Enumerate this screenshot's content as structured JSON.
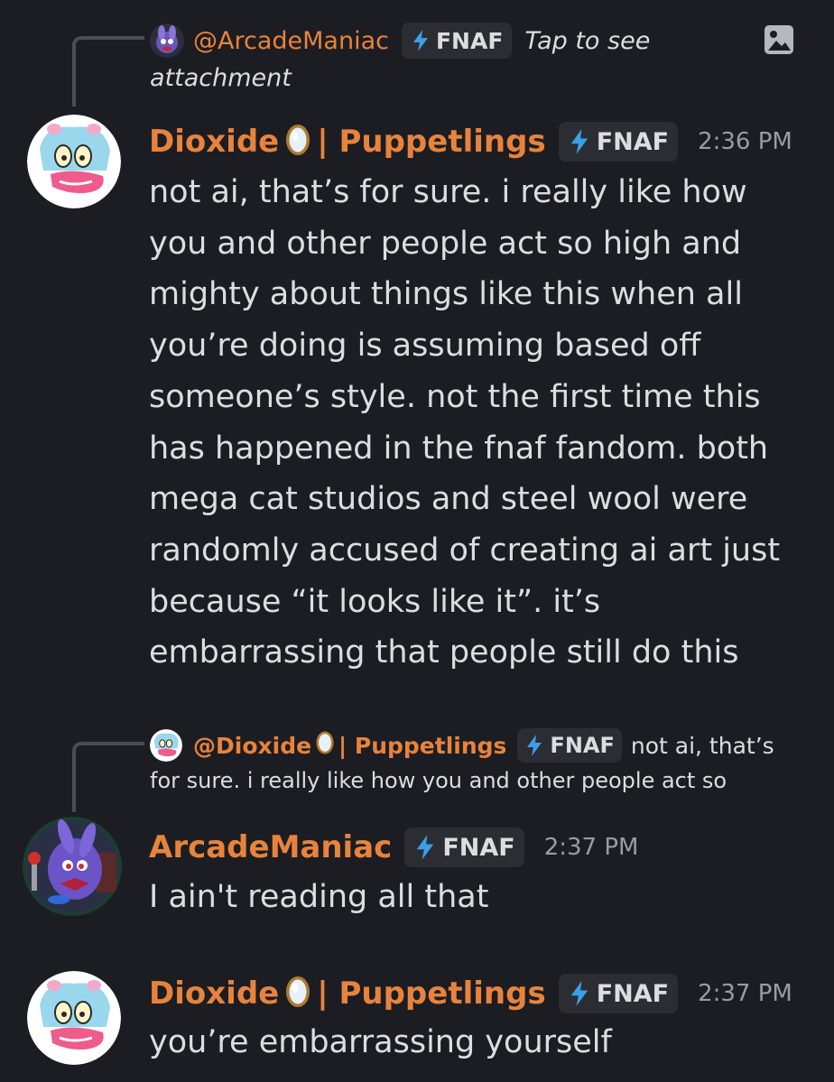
{
  "reply1": {
    "author": "@ArcadeManiac",
    "tag": "FNAF",
    "preview": "Tap to see",
    "preview_cont": "attachment"
  },
  "msg1": {
    "author_a": "Dioxide",
    "author_b": "| Puppetlings",
    "tag": "FNAF",
    "time": "2:36 PM",
    "lines": [
      "not ai, that’s for sure. i really like how",
      "you and other people act so high and",
      "mighty about things like this when all",
      "you’re doing is assuming based off",
      "someone’s style. not the first time this",
      "has happened in the fnaf fandom. both",
      "mega cat studios and steel wool were",
      "randomly accused of creating ai art just",
      "because “it looks like it”. it’s",
      "embarrassing that people still do this"
    ]
  },
  "reply2": {
    "author_a": "@Dioxide",
    "author_b": "| Puppetlings",
    "tag": "FNAF",
    "preview_a": "not ai, that’s",
    "preview_b": "for sure. i really like how you and other people act so"
  },
  "msg2": {
    "author": "ArcadeManiac",
    "tag": "FNAF",
    "time": "2:37 PM",
    "text": "I ain't reading all that"
  },
  "msg3": {
    "author_a": "Dioxide",
    "author_b": "| Puppetlings",
    "tag": "FNAF",
    "time": "2:37 PM",
    "text": "you’re embarrassing yourself"
  },
  "colors": {
    "background": "#1c1d22",
    "username": "#e7833d",
    "text": "#dbdee1",
    "timestamp": "#9a9ca3",
    "tag_bg": "#2b2d33",
    "bolt": "#3aa0e6"
  }
}
